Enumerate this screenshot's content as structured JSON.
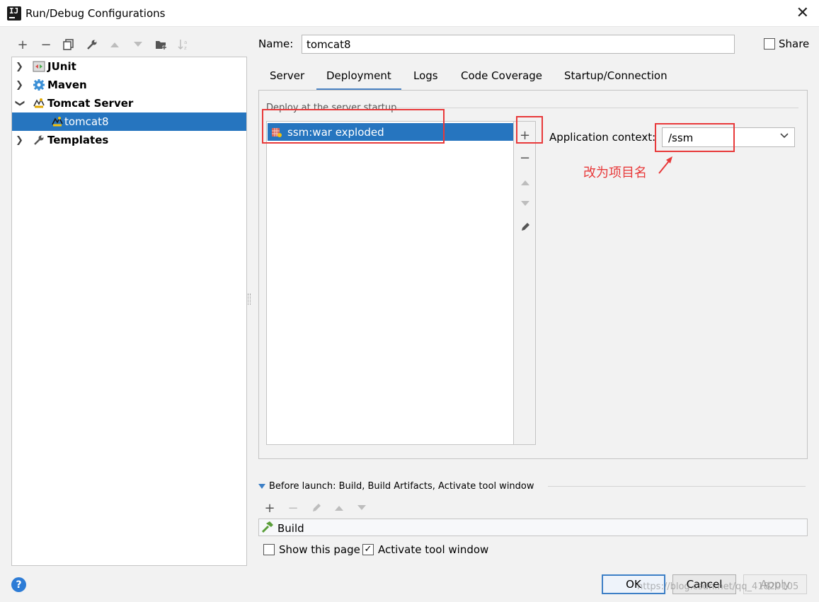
{
  "window": {
    "title": "Run/Debug Configurations",
    "close": "✕"
  },
  "toolbar": {
    "icons": [
      "add-icon",
      "remove-icon",
      "copy-icon",
      "wrench-icon",
      "move-up-icon",
      "move-down-icon",
      "new-folder-icon",
      "sort-icon"
    ]
  },
  "tree": {
    "items": [
      {
        "label": "JUnit",
        "icon": "junit-icon",
        "expanded": false
      },
      {
        "label": "Maven",
        "icon": "maven-icon",
        "expanded": false
      },
      {
        "label": "Tomcat Server",
        "icon": "tomcat-icon",
        "expanded": true
      },
      {
        "label": "tomcat8",
        "icon": "tomcat-icon",
        "selected": true
      },
      {
        "label": "Templates",
        "icon": "wrench-icon",
        "expanded": false
      }
    ]
  },
  "form": {
    "name_label": "Name:",
    "name_value": "tomcat8",
    "share_label": "Share"
  },
  "tabs": [
    {
      "label": "Server",
      "active": false
    },
    {
      "label": "Deployment",
      "active": true
    },
    {
      "label": "Logs",
      "active": false
    },
    {
      "label": "Code Coverage",
      "active": false
    },
    {
      "label": "Startup/Connection",
      "active": false
    }
  ],
  "deployment": {
    "section_label": "Deploy at the server startup",
    "artifacts": [
      "ssm:war exploded"
    ],
    "context_label": "Application context:",
    "context_value": "/ssm",
    "annotation": "改为项目名"
  },
  "before_launch": {
    "label": "Before launch: Build, Build Artifacts, Activate tool window",
    "tasks": [
      "Build"
    ]
  },
  "options": {
    "show_page_label": "Show this page",
    "show_page_checked": false,
    "activate_label": "Activate tool window",
    "activate_checked": true
  },
  "buttons": {
    "ok": "OK",
    "cancel": "Cancel",
    "apply": "Apply",
    "help": "?"
  },
  "watermark": "https://blog.csdn.net/qq_41820105",
  "colors": {
    "selection": "#2675bf",
    "accent": "#3d7fc6",
    "annotation_red": "#e8393a"
  }
}
